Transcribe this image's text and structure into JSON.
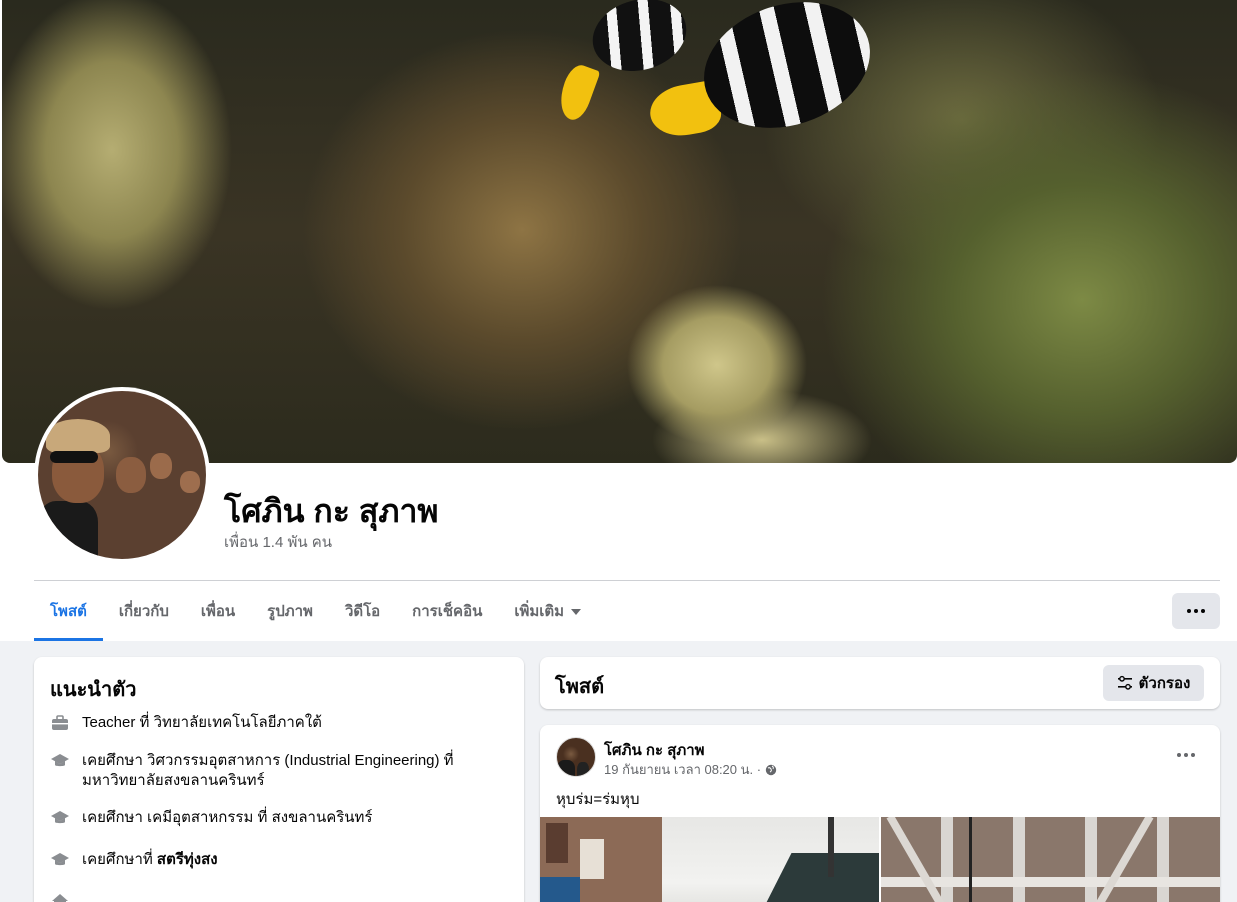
{
  "profile": {
    "name": "โศภิน กะ สุภาพ",
    "friends_count": "เพื่อน 1.4 พัน คน"
  },
  "tabs": [
    {
      "label": "โพสต์",
      "active": true
    },
    {
      "label": "เกี่ยวกับ",
      "active": false
    },
    {
      "label": "เพื่อน",
      "active": false
    },
    {
      "label": "รูปภาพ",
      "active": false
    },
    {
      "label": "วิดีโอ",
      "active": false
    },
    {
      "label": "การเช็คอิน",
      "active": false
    },
    {
      "label": "เพิ่มเติม",
      "active": false
    }
  ],
  "intro": {
    "title": "แนะนำตัว",
    "items": [
      {
        "icon": "briefcase-icon",
        "text": "Teacher ที่ วิทยาลัยเทคโนโลยีภาคใต้"
      },
      {
        "icon": "graduation-cap-icon",
        "text": "เคยศึกษา วิศวกรรมอุตสาหการ (Industrial Engineering) ที่ มหาวิทยาลัยสงขลานครินทร์"
      },
      {
        "icon": "graduation-cap-icon",
        "text": "เคยศึกษา เคมีอุตสาหกรรม ที่ สงขลานครินทร์"
      },
      {
        "icon": "graduation-cap-icon",
        "prefix": "เคยศึกษาที่ ",
        "bold": "สตรีทุ่งสง"
      }
    ]
  },
  "posts_section": {
    "title": "โพสต์",
    "filter_label": "ตัวกรอง"
  },
  "post": {
    "author": "โศภิน กะ สุภาพ",
    "timestamp": "19 กันยายน เวลา 08:20 น. ·",
    "privacy_icon": "globe-icon",
    "text": "หุบร่ม=ร่มหุบ"
  },
  "colors": {
    "accent": "#1b74e4",
    "secondary_text": "#65676b",
    "background": "#f0f2f5",
    "button_bg": "#e4e6eb"
  }
}
